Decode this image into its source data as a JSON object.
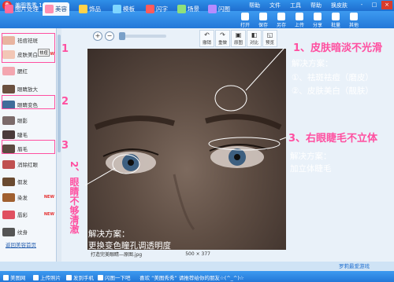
{
  "app": {
    "title": "美图秀秀 1.4.9",
    "logo_text": "秀"
  },
  "menu": [
    "帮助",
    "文件",
    "工具",
    "帮助",
    "换皮肤"
  ],
  "window_buttons": [
    "-",
    "□",
    "×"
  ],
  "tabs": [
    {
      "label": "图片处理",
      "icon_color": "#ff6a9a"
    },
    {
      "label": "美容",
      "icon_color": "#ff8fb0"
    },
    {
      "label": "饰品",
      "icon_color": "#ffd24a"
    },
    {
      "label": "模板",
      "icon_color": "#7fd6ff"
    },
    {
      "label": "闪字",
      "icon_color": "#ff5b5b"
    },
    {
      "label": "场景",
      "icon_color": "#8fe07a"
    },
    {
      "label": "闪图",
      "icon_color": "#b58bff"
    }
  ],
  "right_tools": [
    "打开",
    "保存",
    "另存",
    "上传",
    "分享",
    "批量",
    "其他"
  ],
  "zoom_buttons": [
    "+",
    "−"
  ],
  "edit_buttons": [
    {
      "label": "撤销",
      "glyph": "↶"
    },
    {
      "label": "重做",
      "glyph": "↷"
    },
    {
      "label": "原图",
      "glyph": "▣"
    },
    {
      "label": "对比",
      "glyph": "◧"
    },
    {
      "label": "预览",
      "glyph": "◱"
    }
  ],
  "sidebar": {
    "items": [
      {
        "label": "祛痘祛斑",
        "color": "#e8b4a0",
        "badge": ""
      },
      {
        "label": "皮肤美白",
        "color": "#f2c7b6",
        "badge": "NEW"
      },
      {
        "label": "腮红",
        "color": "#f3a6b0",
        "badge": ""
      },
      {
        "label": "眼睛放大",
        "color": "#6a5040",
        "badge": ""
      },
      {
        "label": "眼睛变色",
        "color": "#3f6d9a",
        "badge": ""
      },
      {
        "label": "眼影",
        "color": "#7b6a6a",
        "badge": ""
      },
      {
        "label": "睫毛",
        "color": "#4a3a3a",
        "badge": ""
      },
      {
        "label": "眉毛",
        "color": "#5a4a40",
        "badge": ""
      },
      {
        "label": "消除红眼",
        "color": "#c05050",
        "badge": ""
      },
      {
        "label": "假发",
        "color": "#6a4a30",
        "badge": ""
      },
      {
        "label": "染发",
        "color": "#a06030",
        "badge": "NEW"
      },
      {
        "label": "唇彩",
        "color": "#e05060",
        "badge": "NEW"
      },
      {
        "label": "纹身",
        "color": "#555555",
        "badge": ""
      }
    ],
    "bottom_link": "返回美容首页"
  },
  "tooltip": "祛痘",
  "status": {
    "filename": "打造完美眼睛—原图.jpg",
    "dimensions": "500 × 377"
  },
  "annotations": [
    {
      "text": "1、皮肤暗淡不光滑"
    },
    {
      "text": "解决方案："
    },
    {
      "text": "①、祛斑祛痘（磨皮）"
    },
    {
      "text": "②、皮肤美白（靓肤）"
    },
    {
      "text": "3、右眼睫毛不立体"
    },
    {
      "text": "解决方案："
    },
    {
      "text": "加立体睫毛"
    },
    {
      "text": "2、眼睛不够清澈"
    },
    {
      "text": "解决方案："
    },
    {
      "text": "更换变色瞳孔调透明度"
    }
  ],
  "markers": [
    "1",
    "2",
    "3"
  ],
  "bottombar": {
    "items": [
      "美图网",
      "上传照片",
      "发到手机",
      "闪图一下吧"
    ],
    "ticker": "喜欢 “美图秀秀” 请推荐给你的朋友☆(^_^)☆",
    "link": "罗莉最爱游戏"
  },
  "colors": {
    "annotation": "#ff4fa0",
    "brand": "#2378d8"
  }
}
